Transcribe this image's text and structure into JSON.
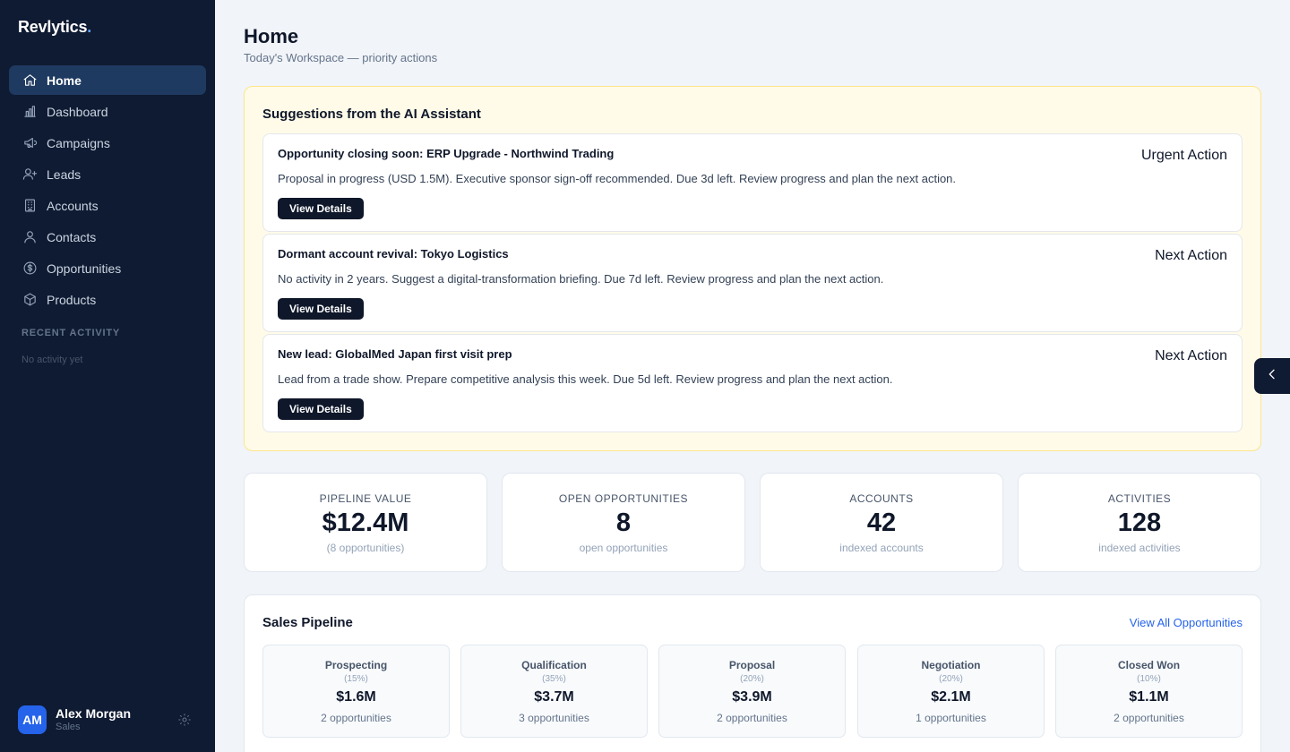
{
  "brand": {
    "name": "Revlytics",
    "dot": "."
  },
  "sidebar": {
    "items": [
      {
        "label": "Home",
        "icon": "home-icon"
      },
      {
        "label": "Dashboard",
        "icon": "bar-chart-icon"
      },
      {
        "label": "Campaigns",
        "icon": "megaphone-icon"
      },
      {
        "label": "Leads",
        "icon": "user-plus-icon"
      },
      {
        "label": "Accounts",
        "icon": "building-icon"
      },
      {
        "label": "Contacts",
        "icon": "user-icon"
      },
      {
        "label": "Opportunities",
        "icon": "dollar-circle-icon"
      },
      {
        "label": "Products",
        "icon": "box-icon"
      }
    ],
    "recent_label": "RECENT ACTIVITY",
    "recent_empty": "No activity yet"
  },
  "user": {
    "initials": "AM",
    "name": "Alex Morgan",
    "role": "Sales"
  },
  "header": {
    "title": "Home",
    "subtitle": "Today's Workspace — priority actions"
  },
  "ai": {
    "title": "Suggestions from the AI Assistant",
    "suggestions": [
      {
        "title": "Opportunity closing soon: ERP Upgrade - Northwind Trading",
        "tag": "Urgent Action",
        "desc": "Proposal in progress (USD 1.5M). Executive sponsor sign-off recommended. Due 3d left. Review progress and plan the next action.",
        "button": "View Details"
      },
      {
        "title": "Dormant account revival: Tokyo Logistics",
        "tag": "Next Action",
        "desc": "No activity in 2 years. Suggest a digital-transformation briefing. Due 7d left. Review progress and plan the next action.",
        "button": "View Details"
      },
      {
        "title": "New lead: GlobalMed Japan first visit prep",
        "tag": "Next Action",
        "desc": "Lead from a trade show. Prepare competitive analysis this week. Due 5d left. Review progress and plan the next action.",
        "button": "View Details"
      }
    ]
  },
  "stats": [
    {
      "label": "PIPELINE VALUE",
      "value": "$12.4M",
      "note": "(8 opportunities)"
    },
    {
      "label": "OPEN OPPORTUNITIES",
      "value": "8",
      "note": "open opportunities"
    },
    {
      "label": "ACCOUNTS",
      "value": "42",
      "note": "indexed accounts"
    },
    {
      "label": "ACTIVITIES",
      "value": "128",
      "note": "indexed activities"
    }
  ],
  "pipeline": {
    "title": "Sales Pipeline",
    "link": "View All Opportunities",
    "stages": [
      {
        "name": "Prospecting",
        "pct": "(15%)",
        "value": "$1.6M",
        "count": "2 opportunities"
      },
      {
        "name": "Qualification",
        "pct": "(35%)",
        "value": "$3.7M",
        "count": "3 opportunities"
      },
      {
        "name": "Proposal",
        "pct": "(20%)",
        "value": "$3.9M",
        "count": "2 opportunities"
      },
      {
        "name": "Negotiation",
        "pct": "(20%)",
        "value": "$2.1M",
        "count": "1 opportunities"
      },
      {
        "name": "Closed Won",
        "pct": "(10%)",
        "value": "$1.1M",
        "count": "2 opportunities"
      }
    ]
  },
  "colors": {
    "sidebar_bg": "#0f1b33",
    "active_bg": "#1f3a60",
    "accent": "#2563eb",
    "ai_panel_bg": "#fffbe8"
  }
}
